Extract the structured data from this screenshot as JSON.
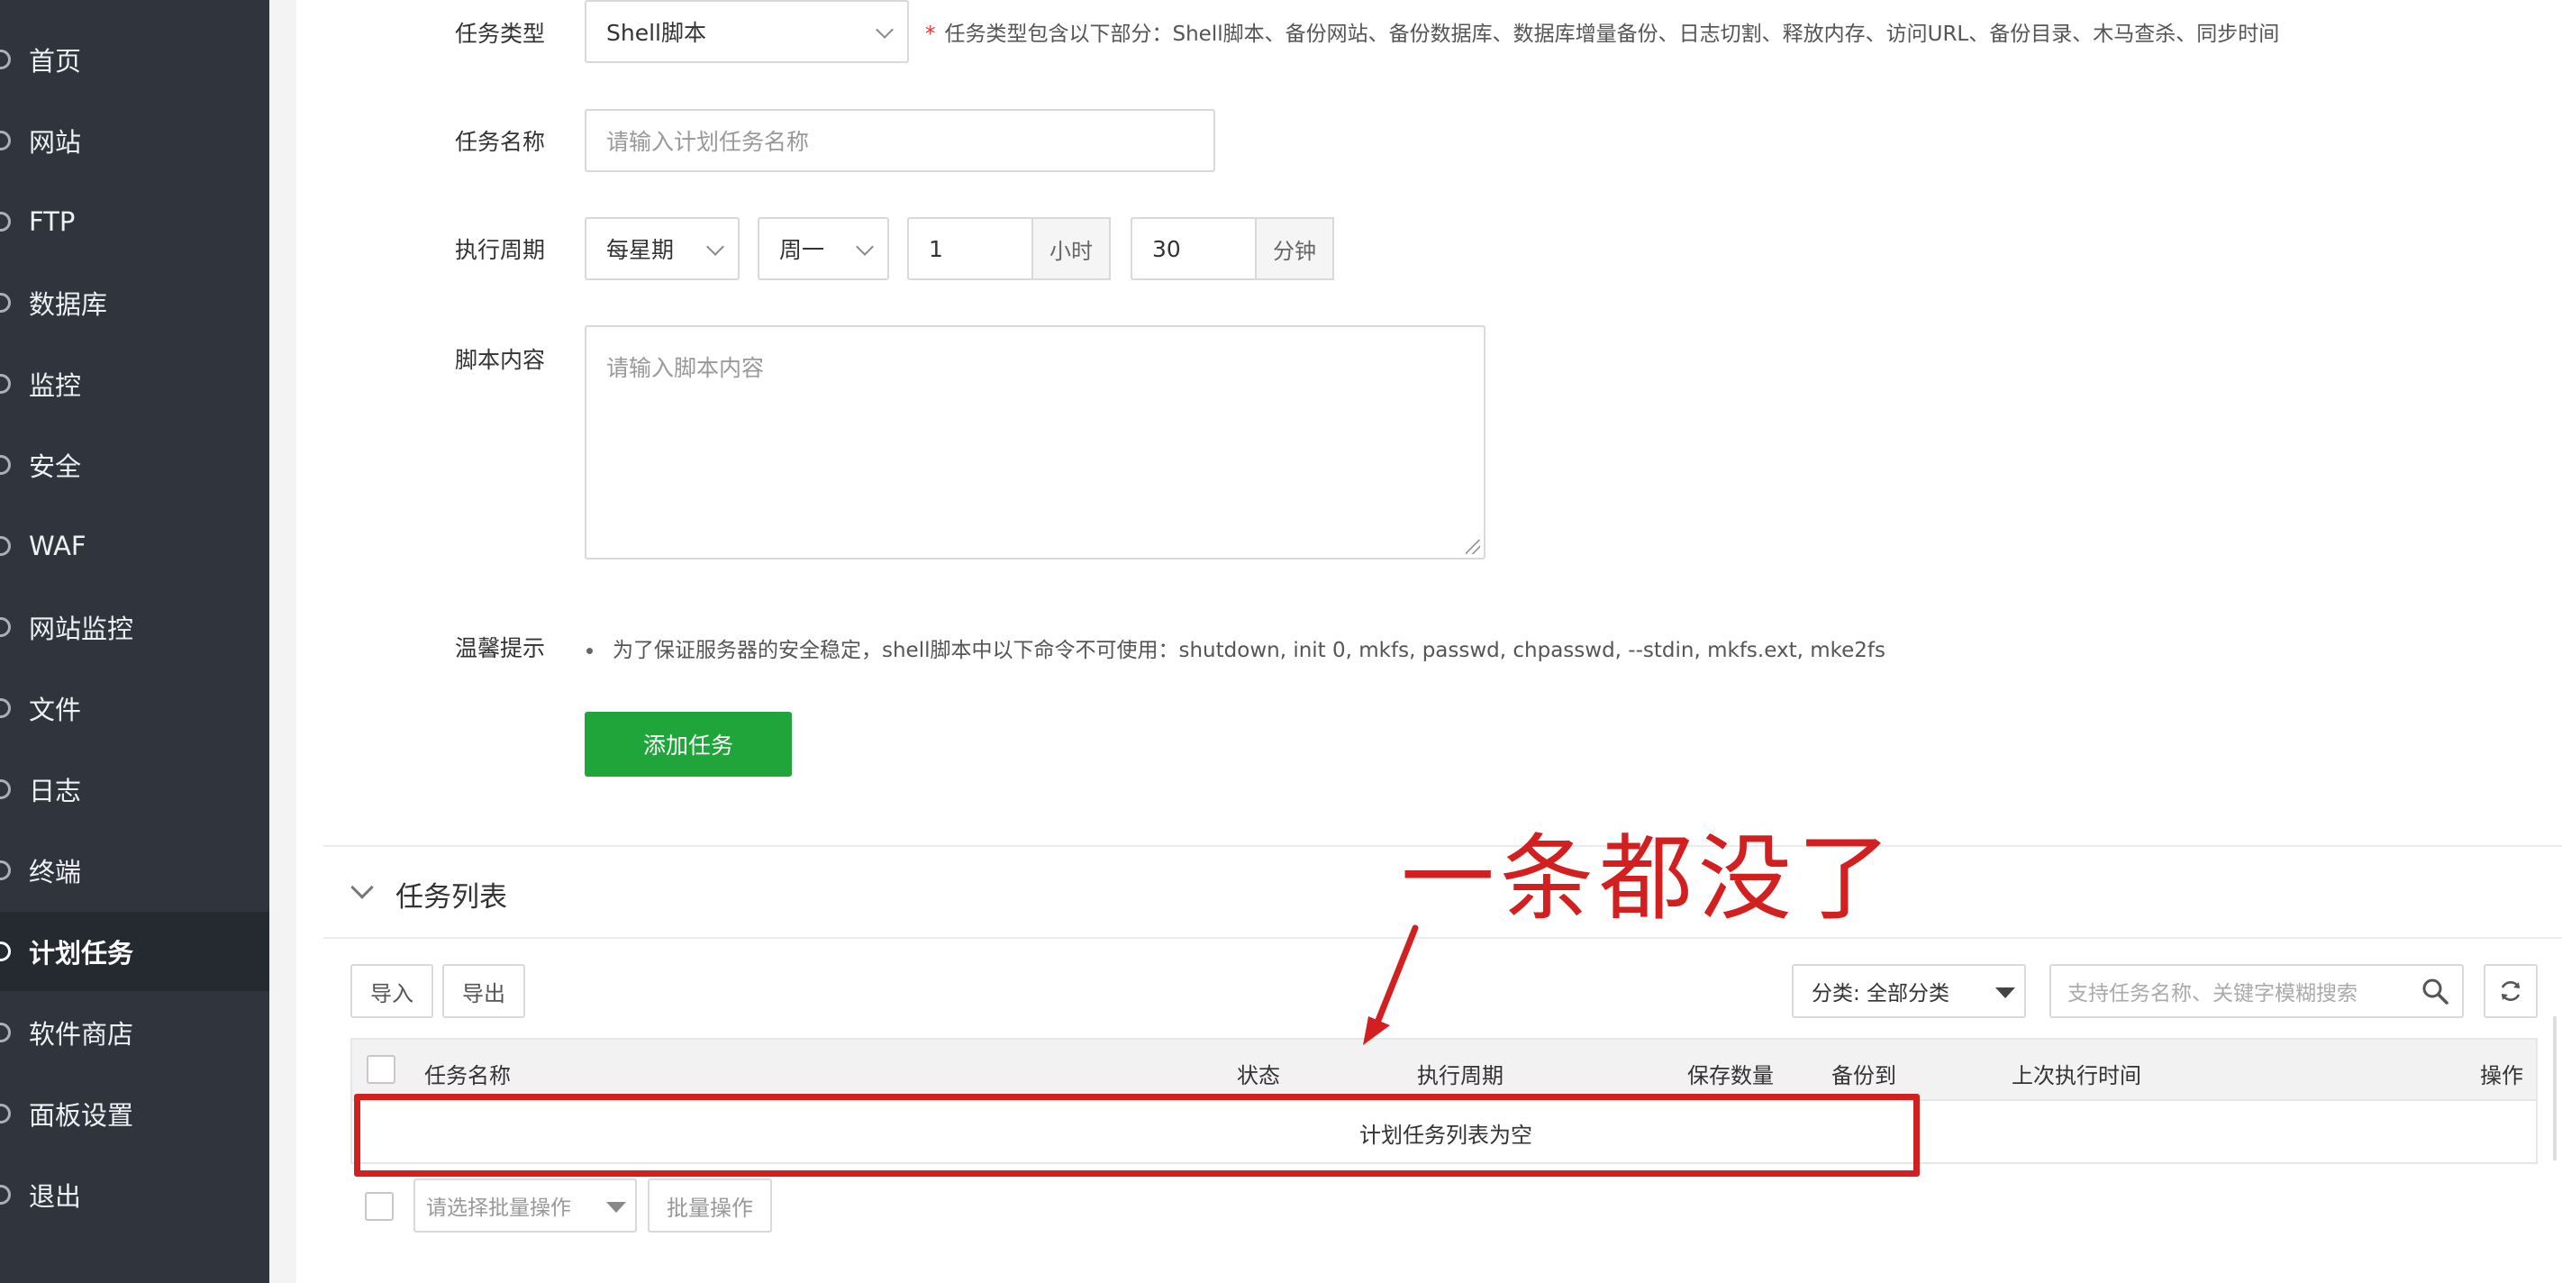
{
  "sidebar": {
    "items": [
      {
        "label": "首页",
        "active": false
      },
      {
        "label": "网站",
        "active": false
      },
      {
        "label": "FTP",
        "active": false
      },
      {
        "label": "数据库",
        "active": false
      },
      {
        "label": "监控",
        "active": false
      },
      {
        "label": "安全",
        "active": false
      },
      {
        "label": "WAF",
        "active": false
      },
      {
        "label": "网站监控",
        "active": false
      },
      {
        "label": "文件",
        "active": false
      },
      {
        "label": "日志",
        "active": false
      },
      {
        "label": "终端",
        "active": false
      },
      {
        "label": "计划任务",
        "active": true
      },
      {
        "label": "软件商店",
        "active": false
      },
      {
        "label": "面板设置",
        "active": false
      },
      {
        "label": "退出",
        "active": false
      }
    ]
  },
  "form": {
    "task_type_label": "任务类型",
    "task_type_value": "Shell脚本",
    "task_type_hint_star": "*",
    "task_type_hint": "任务类型包含以下部分：Shell脚本、备份网站、备份数据库、数据库增量备份、日志切割、释放内存、访问URL、备份目录、木马查杀、同步时间",
    "task_name_label": "任务名称",
    "task_name_placeholder": "请输入计划任务名称",
    "cycle_label": "执行周期",
    "cycle_period": "每星期",
    "cycle_weekday": "周一",
    "cycle_hour": "1",
    "cycle_hour_unit": "小时",
    "cycle_minute": "30",
    "cycle_minute_unit": "分钟",
    "script_label": "脚本内容",
    "script_placeholder": "请输入脚本内容",
    "tip_label": "温馨提示",
    "tip_text": "为了保证服务器的安全稳定，shell脚本中以下命令不可使用：shutdown, init 0, mkfs, passwd, chpasswd, --stdin, mkfs.ext, mke2fs",
    "add_button": "添加任务"
  },
  "task_list": {
    "title": "任务列表",
    "import_button": "导入",
    "export_button": "导出",
    "category_select": "分类: 全部分类",
    "search_placeholder": "支持任务名称、关键字模糊搜索",
    "columns": [
      "任务名称",
      "状态",
      "执行周期",
      "保存数量",
      "备份到",
      "上次执行时间",
      "操作"
    ],
    "empty_text": "计划任务列表为空",
    "batch_select_placeholder": "请选择批量操作",
    "batch_button": "批量操作"
  },
  "annotation": {
    "text": "一条都没了",
    "color": "#d21f1f"
  },
  "colors": {
    "sidebar_bg": "#30353d",
    "sidebar_active_bg": "#252a31",
    "primary_green": "#20a53a"
  }
}
